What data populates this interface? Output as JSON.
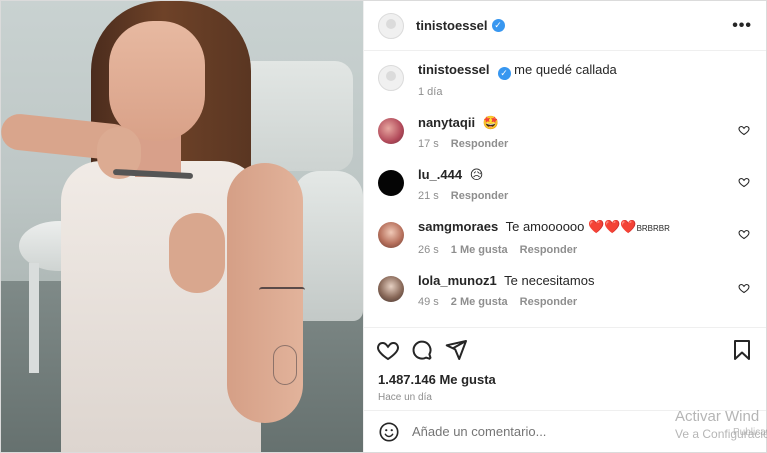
{
  "post": {
    "username": "tinistoessel",
    "more_label": "•••",
    "caption": "me quedé callada",
    "caption_time": "1 día"
  },
  "comments": [
    {
      "username": "nanytaqii",
      "text": "🤩",
      "time": "17 s",
      "like_label": "",
      "reply_label": "Responder"
    },
    {
      "username": "lu_.444",
      "text": "😥",
      "time": "21 s",
      "like_label": "",
      "reply_label": "Responder"
    },
    {
      "username": "samgmoraes",
      "text": "Te amoooooo ❤️❤️❤️",
      "tail": "BRBRBR",
      "time": "26 s",
      "like_label": "1 Me gusta",
      "reply_label": "Responder"
    },
    {
      "username": "lola_munoz1",
      "text": "Te necesitamos",
      "time": "49 s",
      "like_label": "2 Me gusta",
      "reply_label": "Responder"
    }
  ],
  "likes": "1.487.146 Me gusta",
  "posted": "Hace un día",
  "comment_input": {
    "placeholder": "Añade un comentario..."
  },
  "watermark": {
    "line1": "Activar Wind",
    "line2": "Ve a Configuració",
    "extra": "Publicar"
  },
  "colors": {
    "verified": "#3897f0",
    "heart_red": "#ed4956"
  },
  "icons": [
    "heart-icon",
    "comment-icon",
    "share-icon",
    "bookmark-icon",
    "emoji-icon",
    "more-icon",
    "verified-badge-icon"
  ]
}
